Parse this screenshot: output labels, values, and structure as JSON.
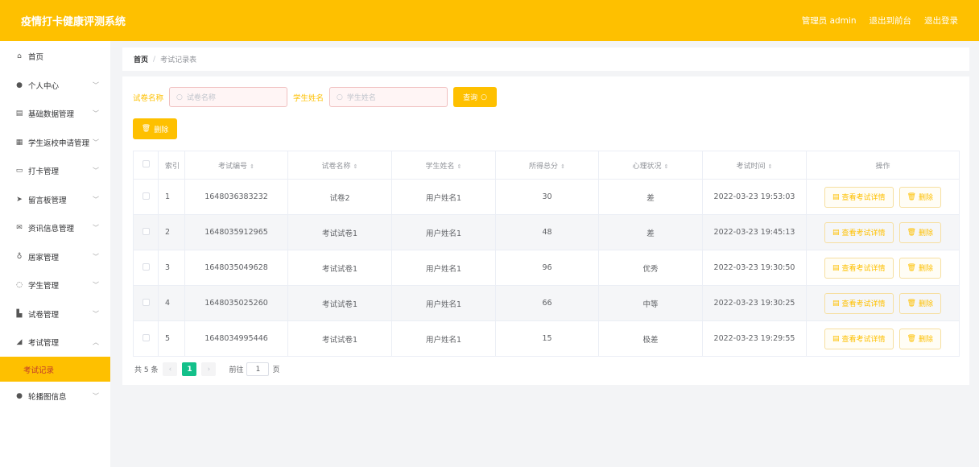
{
  "app": {
    "title": "疫情打卡健康评测系统"
  },
  "topbar": {
    "admin": "管理员 admin",
    "to_front": "退出到前台",
    "logout": "退出登录"
  },
  "sidebar": {
    "items": [
      {
        "label": "首页",
        "icon": "home-icon",
        "arrow": ""
      },
      {
        "label": "个人中心",
        "icon": "user-icon",
        "arrow": "﹀"
      },
      {
        "label": "基础数据管理",
        "icon": "book-icon",
        "arrow": "﹀"
      },
      {
        "label": "学生返校申请管理",
        "icon": "grid-icon",
        "arrow": "﹀"
      },
      {
        "label": "打卡管理",
        "icon": "chat-icon",
        "arrow": "﹀"
      },
      {
        "label": "留言板管理",
        "icon": "send-icon",
        "arrow": "﹀"
      },
      {
        "label": "资讯信息管理",
        "icon": "mail-icon",
        "arrow": "﹀"
      },
      {
        "label": "居家管理",
        "icon": "mic-icon",
        "arrow": "﹀"
      },
      {
        "label": "学生管理",
        "icon": "power-icon",
        "arrow": "﹀"
      },
      {
        "label": "试卷管理",
        "icon": "thumb-icon",
        "arrow": "﹀"
      },
      {
        "label": "考试管理",
        "icon": "telegram-icon",
        "arrow": "︿"
      }
    ],
    "sub_active": "考试记录",
    "last": {
      "label": "轮播图信息",
      "icon": "user-icon",
      "arrow": "﹀"
    }
  },
  "breadcrumb": {
    "home": "首页",
    "sep": "/",
    "current": "考试记录表"
  },
  "search": {
    "paper_label": "试卷名称",
    "paper_placeholder": "试卷名称",
    "student_label": "学生姓名",
    "student_placeholder": "学生姓名",
    "query": "查询"
  },
  "actions": {
    "delete": "删除"
  },
  "table": {
    "headers": [
      "索引",
      "考试编号",
      "试卷名称",
      "学生姓名",
      "所得总分",
      "心理状况",
      "考试时间",
      "操作"
    ],
    "rows": [
      {
        "idx": "1",
        "no": "1648036383232",
        "paper": "试卷2",
        "student": "用户姓名1",
        "score": "30",
        "mind": "差",
        "time": "2022-03-23 19:53:03"
      },
      {
        "idx": "2",
        "no": "1648035912965",
        "paper": "考试试卷1",
        "student": "用户姓名1",
        "score": "48",
        "mind": "差",
        "time": "2022-03-23 19:45:13"
      },
      {
        "idx": "3",
        "no": "1648035049628",
        "paper": "考试试卷1",
        "student": "用户姓名1",
        "score": "96",
        "mind": "优秀",
        "time": "2022-03-23 19:30:50"
      },
      {
        "idx": "4",
        "no": "1648035025260",
        "paper": "考试试卷1",
        "student": "用户姓名1",
        "score": "66",
        "mind": "中等",
        "time": "2022-03-23 19:30:25"
      },
      {
        "idx": "5",
        "no": "1648034995446",
        "paper": "考试试卷1",
        "student": "用户姓名1",
        "score": "15",
        "mind": "极差",
        "time": "2022-03-23 19:29:55"
      }
    ],
    "op_view": "查看考试详情",
    "op_delete": "删除"
  },
  "pager": {
    "total": "共 5 条",
    "page": "1",
    "goto": "前往",
    "goto_value": "1",
    "page_unit": "页"
  },
  "colors": {
    "accent": "#fec000",
    "pager_active": "#13c08a"
  }
}
